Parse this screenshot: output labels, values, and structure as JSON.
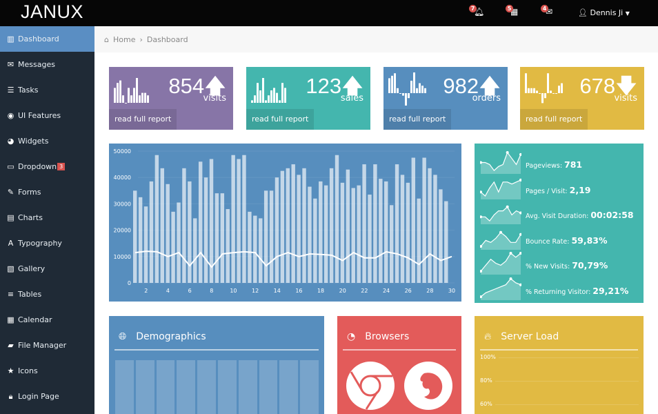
{
  "brand": "JANUX",
  "topnav": {
    "notifications": {
      "icon": "bell-icon",
      "count": "7"
    },
    "calendar": {
      "icon": "calendar-icon",
      "count": "5"
    },
    "messages": {
      "icon": "envelope-icon",
      "count": "4"
    },
    "user": "Dennis Ji"
  },
  "sidebar": {
    "items": [
      {
        "label": "Dashboard",
        "icon": "dashboard-icon",
        "active": true
      },
      {
        "label": "Messages",
        "icon": "envelope-icon"
      },
      {
        "label": "Tasks",
        "icon": "tasks-icon"
      },
      {
        "label": "UI Features",
        "icon": "eye-icon"
      },
      {
        "label": "Widgets",
        "icon": "dashboard-gauge-icon"
      },
      {
        "label": "Dropdown",
        "icon": "folder-icon",
        "badge": "3"
      },
      {
        "label": "Forms",
        "icon": "edit-icon"
      },
      {
        "label": "Charts",
        "icon": "chart-icon"
      },
      {
        "label": "Typography",
        "icon": "font-icon"
      },
      {
        "label": "Gallery",
        "icon": "picture-icon"
      },
      {
        "label": "Tables",
        "icon": "table-icon"
      },
      {
        "label": "Calendar",
        "icon": "calendar-icon"
      },
      {
        "label": "File Manager",
        "icon": "folder-open-icon"
      },
      {
        "label": "Icons",
        "icon": "star-icon"
      },
      {
        "label": "Login Page",
        "icon": "lock-icon"
      }
    ]
  },
  "breadcrumb": {
    "home": "Home",
    "current": "Dashboard"
  },
  "stats": [
    {
      "value": "854",
      "label": "visits",
      "trend": "up",
      "link": "read full report",
      "color": "#8775a7",
      "spark": [
        6,
        8,
        9,
        3,
        0,
        6,
        3,
        6,
        10,
        3,
        4,
        4,
        3
      ]
    },
    {
      "value": "123",
      "label": "sales",
      "trend": "up",
      "link": "read full report",
      "color": "#44b6ae",
      "spark": [
        1,
        3,
        8,
        5,
        10,
        1,
        3,
        5,
        6,
        4,
        1,
        8,
        6
      ]
    },
    {
      "value": "982",
      "label": "orders",
      "trend": "up",
      "link": "read full report",
      "color": "#578ebe",
      "spark": [
        6,
        7,
        8,
        2,
        0,
        -1,
        -5,
        -2,
        5,
        9,
        2,
        4,
        3,
        2
      ]
    },
    {
      "value": "678",
      "label": "visits",
      "trend": "down",
      "link": "read full report",
      "color": "#e1ba43",
      "spark": [
        8,
        2,
        2,
        2,
        1,
        0,
        -4,
        -2,
        8,
        1,
        0,
        0,
        3,
        4
      ]
    }
  ],
  "chart_data": {
    "type": "bar",
    "categories": [
      1,
      2,
      3,
      4,
      5,
      6,
      7,
      8,
      9,
      10,
      11,
      12,
      13,
      14,
      15,
      16,
      17,
      18,
      19,
      20,
      21,
      22,
      23,
      24,
      25,
      26,
      27,
      28,
      29,
      30
    ],
    "series": [
      {
        "name": "bars",
        "type": "bar",
        "values": [
          35000,
          32500,
          29000,
          38500,
          48500,
          43500,
          37500,
          27000,
          30500,
          43500,
          38500,
          24500,
          46000,
          40000,
          47000,
          34000,
          34000,
          28000,
          48500,
          47000,
          48500,
          27000,
          25500,
          24500,
          35000,
          35000,
          40000,
          42500,
          43500,
          45000,
          41000,
          43500,
          36500,
          32000,
          38500,
          37000,
          43500,
          48500,
          38000,
          43000,
          36000,
          37000,
          45000,
          33500,
          45000,
          39500,
          38500,
          29500,
          45000,
          41000,
          38000,
          47500,
          32000,
          47500,
          43500,
          41000,
          35500,
          31000
        ]
      },
      {
        "name": "line",
        "type": "line",
        "values": [
          11500,
          12000,
          11800,
          10000,
          11500,
          6500,
          11500,
          6000,
          11000,
          11500,
          11800,
          11500,
          6500,
          10000,
          11500,
          10000,
          11000,
          10800,
          10500,
          8500,
          11500,
          9500,
          9500,
          11800,
          11000,
          9500,
          7000,
          11000,
          8500,
          10000
        ]
      }
    ],
    "ylim": [
      0,
      50000
    ],
    "yticks": [
      "0",
      "10000",
      "20000",
      "30000",
      "40000",
      "50000"
    ],
    "xticks": [
      "2",
      "4",
      "6",
      "8",
      "10",
      "12",
      "14",
      "16",
      "18",
      "20",
      "22",
      "24",
      "26",
      "28",
      "30"
    ]
  },
  "metrics": [
    {
      "label": "Pageviews:",
      "value": "781",
      "spark": [
        5,
        5,
        4,
        1,
        3,
        4,
        10,
        7,
        4,
        9
      ]
    },
    {
      "label": "Pages / Visit:",
      "value": "2,19",
      "spark": [
        3,
        1,
        5,
        8,
        3,
        8,
        8,
        7,
        8,
        9
      ]
    },
    {
      "label": "Avg. Visit Duration:",
      "value": "00:02:58",
      "spark": [
        3,
        3,
        1,
        4,
        6,
        6,
        8,
        4,
        6,
        5
      ]
    },
    {
      "label": "Bounce Rate:",
      "value": "59,83%",
      "spark": [
        1,
        4,
        3,
        5,
        8,
        6,
        3,
        3,
        7
      ]
    },
    {
      "label": "% New Visits:",
      "value": "70,79%",
      "spark": [
        1,
        4,
        7,
        5,
        4,
        6,
        10,
        8,
        10
      ]
    },
    {
      "label": "% Returning Visitor:",
      "value": "29,21%",
      "spark": [
        1,
        3,
        4,
        5,
        6,
        7,
        10,
        8,
        7
      ]
    }
  ],
  "panels": {
    "demographics": {
      "title": "Demographics",
      "icon": "globe-icon",
      "color": "#578ebe"
    },
    "browsers": {
      "title": "Browsers",
      "icon": "pie-icon",
      "color": "#e35b5a",
      "items": [
        "chrome-icon",
        "firefox-icon"
      ]
    },
    "server": {
      "title": "Server Load",
      "icon": "fire-icon",
      "color": "#e1ba43",
      "yticks": [
        "100%",
        "80%",
        "60%"
      ]
    }
  }
}
